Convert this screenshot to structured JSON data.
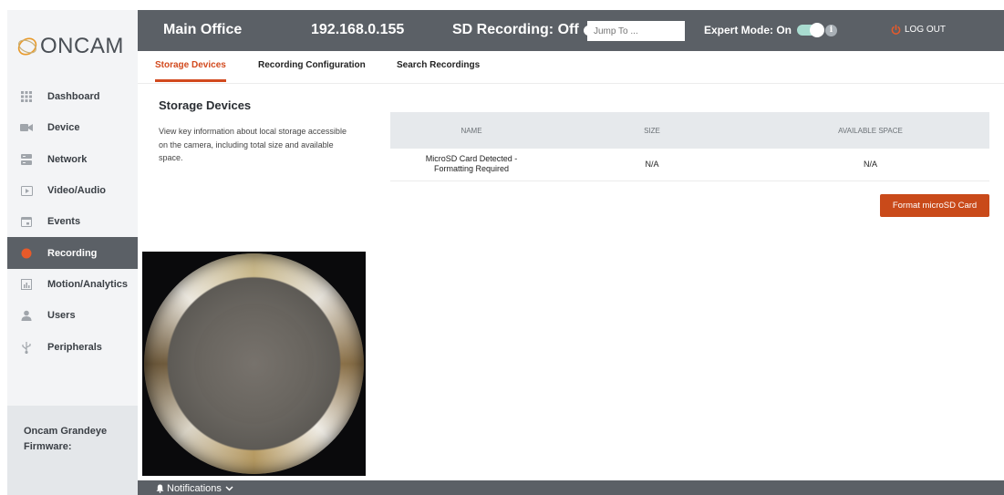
{
  "brand": {
    "logo_text": "ONCAM"
  },
  "sidebar": {
    "items": [
      {
        "label": "Dashboard",
        "icon": "grid-icon"
      },
      {
        "label": "Device",
        "icon": "camera-icon"
      },
      {
        "label": "Network",
        "icon": "server-icon"
      },
      {
        "label": "Video/Audio",
        "icon": "play-icon"
      },
      {
        "label": "Events",
        "icon": "calendar-icon"
      },
      {
        "label": "Recording",
        "icon": "record-dot-icon"
      },
      {
        "label": "Motion/Analytics",
        "icon": "bar-chart-icon"
      },
      {
        "label": "Users",
        "icon": "user-icon"
      },
      {
        "label": "Peripherals",
        "icon": "usb-icon"
      }
    ],
    "firmware_line1": "Oncam Grandeye",
    "firmware_line2": "Firmware:"
  },
  "header": {
    "site_name": "Main Office",
    "ip": "192.168.0.155",
    "sd_recording": "SD Recording: Off",
    "jump_placeholder": "Jump To ...",
    "expert_mode": "Expert Mode: On",
    "info_glyph": "i",
    "logout": "LOG OUT"
  },
  "tabs": [
    {
      "label": "Storage Devices"
    },
    {
      "label": "Recording Configuration"
    },
    {
      "label": "Search Recordings"
    }
  ],
  "content": {
    "title": "Storage Devices",
    "description": "View key information about local storage accessible on the camera, including total size and available space.",
    "table": {
      "headers": [
        "NAME",
        "SIZE",
        "AVAILABLE SPACE"
      ],
      "row": {
        "name_line1": "MicroSD Card Detected -",
        "name_line2": "Formatting Required",
        "size": "N/A",
        "available": "N/A"
      }
    },
    "format_button": "Format microSD Card"
  },
  "footer": {
    "notifications": "Notifications"
  },
  "colors": {
    "accent": "#d24a1e",
    "topbar": "#5b6066",
    "sidebar_bg": "#f3f4f6",
    "toggle_on": "#a9dcd0"
  }
}
